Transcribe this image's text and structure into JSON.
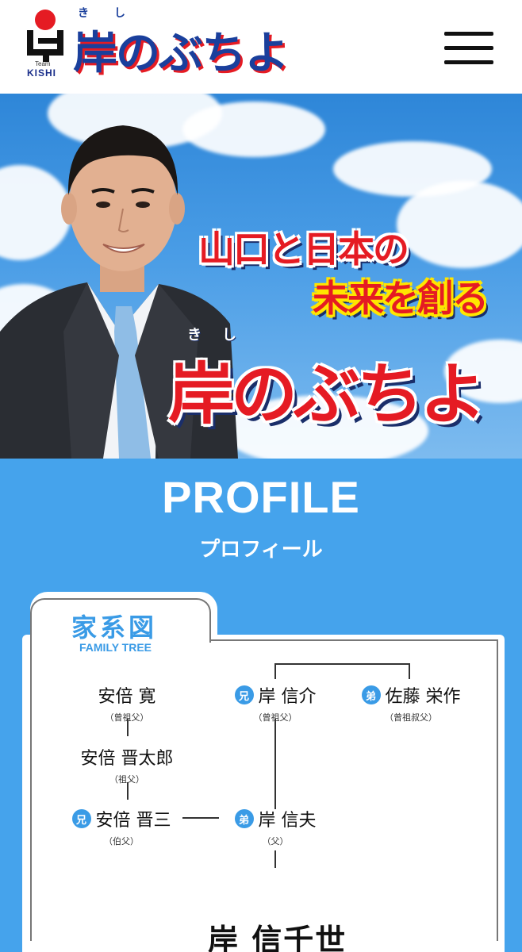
{
  "header": {
    "logo_team": "Team",
    "logo_kishi": "KISHI",
    "name_ruby": [
      "き",
      "し"
    ],
    "name": "岸のぶちよ",
    "menu_icon": "hamburger-menu-icon"
  },
  "hero": {
    "line1": "山口と日本の",
    "line2": "未来を創る",
    "name_ruby": [
      "き",
      "し"
    ],
    "name": "岸のぶちよ"
  },
  "profile": {
    "title": "PROFILE",
    "subtitle": "プロフィール"
  },
  "family_tree": {
    "heading_jp": "家系図",
    "heading_en": "FAMILY TREE",
    "badge_older": "兄",
    "badge_younger": "弟",
    "members": {
      "abe_kan": {
        "name": "安倍 寛",
        "relation": "（曾祖父）"
      },
      "kishi_nobusuke": {
        "name": "岸 信介",
        "relation": "（曾祖父）"
      },
      "sato_eisaku": {
        "name": "佐藤 栄作",
        "relation": "（曾祖叔父）"
      },
      "abe_shintaro": {
        "name": "安倍 晋太郎",
        "relation": "（祖父）"
      },
      "abe_shinzo": {
        "name": "安倍 晋三",
        "relation": "（伯父）"
      },
      "kishi_nobuo": {
        "name": "岸 信夫",
        "relation": "（父）"
      }
    },
    "main_person": "岸 信千世"
  },
  "colors": {
    "brand_red": "#e51b23",
    "brand_navy": "#1a3f9c",
    "profile_blue": "#45a3ec",
    "accent_blue": "#3a9be6"
  }
}
